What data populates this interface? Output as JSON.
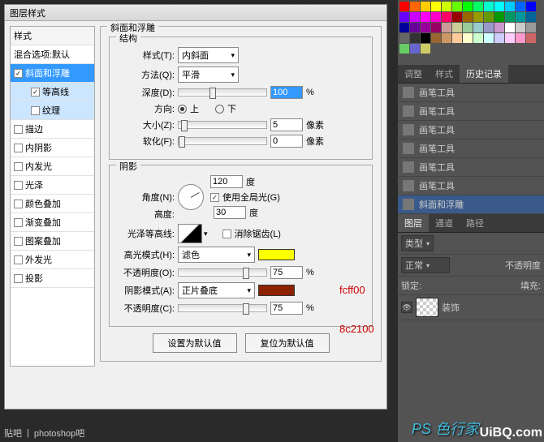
{
  "dialog": {
    "title": "图层样式",
    "sidebar": {
      "header": "样式",
      "blend": "混合选项:默认",
      "items": [
        {
          "label": "斜面和浮雕",
          "checked": true,
          "selected": true
        },
        {
          "label": "等高线",
          "checked": true,
          "sub": true,
          "subsel": true
        },
        {
          "label": "纹理",
          "checked": false,
          "sub": true,
          "subsel": true
        },
        {
          "label": "描边",
          "checked": false
        },
        {
          "label": "内阴影",
          "checked": false
        },
        {
          "label": "内发光",
          "checked": false
        },
        {
          "label": "光泽",
          "checked": false
        },
        {
          "label": "颜色叠加",
          "checked": false
        },
        {
          "label": "渐变叠加",
          "checked": false
        },
        {
          "label": "图案叠加",
          "checked": false
        },
        {
          "label": "外发光",
          "checked": false
        },
        {
          "label": "投影",
          "checked": false
        }
      ]
    },
    "bevel": {
      "title": "斜面和浮雕",
      "struct_title": "结构",
      "style_label": "样式(T):",
      "style_value": "内斜面",
      "tech_label": "方法(Q):",
      "tech_value": "平滑",
      "depth_label": "深度(D):",
      "depth_value": "100",
      "depth_unit": "%",
      "dir_label": "方向:",
      "dir_up": "上",
      "dir_down": "下",
      "size_label": "大小(Z):",
      "size_value": "5",
      "size_unit": "像素",
      "soften_label": "软化(F):",
      "soften_value": "0",
      "soften_unit": "像素"
    },
    "shade": {
      "title": "阴影",
      "angle_label": "角度(N):",
      "angle_value": "120",
      "angle_unit": "度",
      "global_label": "使用全局光(G)",
      "alt_label": "高度:",
      "alt_value": "30",
      "alt_unit": "度",
      "gloss_label": "光泽等高线:",
      "antialias_label": "消除锯齿(L)",
      "hi_mode_label": "高光模式(H):",
      "hi_mode_value": "滤色",
      "hi_color": "#fcff00",
      "hi_annot": "fcff00",
      "hi_opacity_label": "不透明度(O):",
      "hi_opacity_value": "75",
      "pct": "%",
      "sh_mode_label": "阴影模式(A):",
      "sh_mode_value": "正片叠底",
      "sh_color": "#8c2100",
      "sh_annot": "8c2100",
      "sh_opacity_label": "不透明度(C):",
      "sh_opacity_value": "75"
    },
    "buttons": {
      "default": "设置为默认值",
      "reset": "复位为默认值"
    }
  },
  "panels": {
    "swatches": [
      "#f00",
      "#f60",
      "#fc0",
      "#ff0",
      "#cf0",
      "#6f0",
      "#0f0",
      "#0f6",
      "#0fc",
      "#0ff",
      "#0cf",
      "#06f",
      "#00f",
      "#60f",
      "#c0f",
      "#f0f",
      "#f0c",
      "#f06",
      "#900",
      "#960",
      "#990",
      "#690",
      "#090",
      "#096",
      "#099",
      "#069",
      "#009",
      "#609",
      "#909",
      "#906",
      "#c99",
      "#cc9",
      "#9c9",
      "#9cc",
      "#99c",
      "#c9c",
      "#fff",
      "#ccc",
      "#999",
      "#666",
      "#333",
      "#000",
      "#963",
      "#c96",
      "#fc9",
      "#ffc",
      "#cfc",
      "#cff",
      "#ccf",
      "#fcf",
      "#f9c",
      "#c66",
      "#6c6",
      "#66c",
      "#cc6"
    ],
    "tabs_top": [
      "调整",
      "样式",
      "历史记录"
    ],
    "history": [
      {
        "label": "画笔工具"
      },
      {
        "label": "画笔工具"
      },
      {
        "label": "画笔工具"
      },
      {
        "label": "画笔工具"
      },
      {
        "label": "画笔工具"
      },
      {
        "label": "画笔工具"
      },
      {
        "label": "斜面和浮雕",
        "sel": true
      }
    ],
    "tabs_layers": [
      "图层",
      "通道",
      "路径"
    ],
    "kind_label": "类型",
    "mode_value": "正常",
    "opacity_label": "不透明度",
    "lock_label": "锁定:",
    "fill_label": "填充:",
    "layer_name": "装饰"
  },
  "footer": {
    "site": "贴吧",
    "sep": "|",
    "text": "photoshop吧"
  },
  "watermark": "PS 色行家",
  "brand": "UiBQ.com"
}
